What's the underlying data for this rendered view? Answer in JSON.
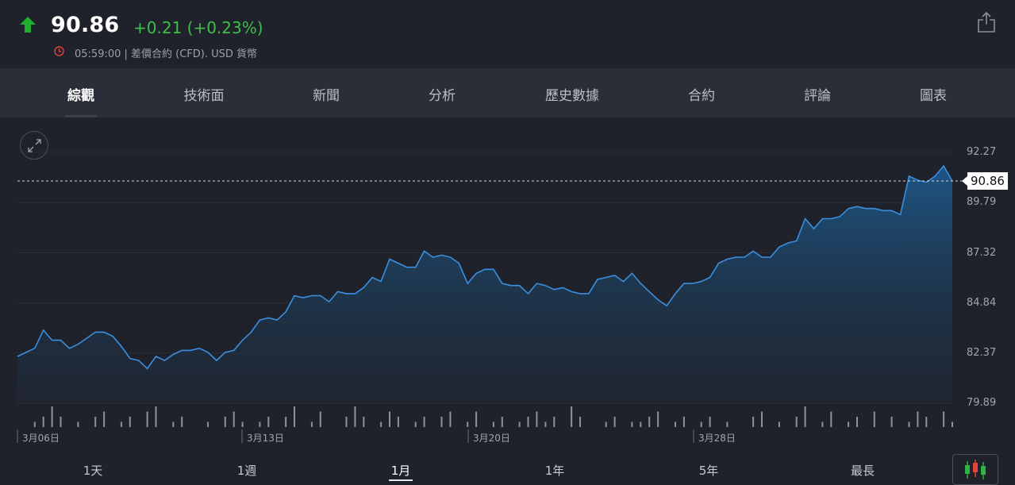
{
  "header": {
    "price": "90.86",
    "change": "+0.21 (+0.23%)",
    "meta": "05:59:00 | 差價合約 (CFD). USD 貨幣",
    "arrow_color": "#1fae2e",
    "change_color": "#3fbf4a",
    "clock_color": "#e0443c"
  },
  "tabs": [
    {
      "label": "綜觀",
      "active": true
    },
    {
      "label": "技術面"
    },
    {
      "label": "新聞"
    },
    {
      "label": "分析"
    },
    {
      "label": "歷史數據"
    },
    {
      "label": "合約"
    },
    {
      "label": "評論"
    },
    {
      "label": "圖表"
    }
  ],
  "chart_data": {
    "type": "area",
    "y_ticks": [
      "92.27",
      "89.79",
      "87.32",
      "84.84",
      "82.37",
      "79.89"
    ],
    "ylim": [
      79.89,
      92.27
    ],
    "x_ticks": [
      "3月06日",
      "3月13日",
      "3月20日",
      "3月28日"
    ],
    "last_price_label": "90.86",
    "line_color": "#3a8fe0",
    "values": [
      82.2,
      82.4,
      82.6,
      83.5,
      83.0,
      83.0,
      82.6,
      82.8,
      83.1,
      83.4,
      83.4,
      83.2,
      82.7,
      82.1,
      82.0,
      81.6,
      82.2,
      82.0,
      82.3,
      82.5,
      82.5,
      82.6,
      82.4,
      82.0,
      82.4,
      82.5,
      83.0,
      83.4,
      84.0,
      84.1,
      84.0,
      84.4,
      85.2,
      85.1,
      85.2,
      85.2,
      84.9,
      85.4,
      85.3,
      85.3,
      85.6,
      86.1,
      85.9,
      87.0,
      86.8,
      86.6,
      86.6,
      87.4,
      87.1,
      87.2,
      87.1,
      86.8,
      85.8,
      86.3,
      86.5,
      86.5,
      85.8,
      85.7,
      85.7,
      85.3,
      85.8,
      85.7,
      85.5,
      85.6,
      85.4,
      85.3,
      85.3,
      86.0,
      86.1,
      86.2,
      85.9,
      86.3,
      85.8,
      85.4,
      85.0,
      84.7,
      85.3,
      85.8,
      85.8,
      85.9,
      86.1,
      86.8,
      87.0,
      87.1,
      87.1,
      87.4,
      87.1,
      87.1,
      87.6,
      87.8,
      87.9,
      89.0,
      88.5,
      89.0,
      89.0,
      89.1,
      89.5,
      89.6,
      89.5,
      89.5,
      89.4,
      89.4,
      89.2,
      91.1,
      90.9,
      90.8,
      91.1,
      91.6,
      90.86
    ],
    "volume": [
      0,
      0,
      1,
      2,
      4,
      2,
      0,
      1,
      0,
      2,
      3,
      0,
      1,
      2,
      0,
      3,
      4,
      0,
      1,
      2,
      0,
      0,
      1,
      0,
      2,
      3,
      1,
      0,
      1,
      2,
      0,
      2,
      4,
      0,
      1,
      3,
      0,
      0,
      2,
      4,
      2,
      0,
      1,
      3,
      2,
      0,
      1,
      2,
      0,
      2,
      3,
      0,
      1,
      3,
      0,
      1,
      2,
      0,
      1,
      2,
      3,
      1,
      2,
      0,
      4,
      2,
      0,
      0,
      1,
      2,
      0,
      1,
      1,
      2,
      3,
      0,
      1,
      2,
      0,
      1,
      2,
      0,
      1,
      0,
      0,
      2,
      3,
      0,
      1,
      0,
      2,
      4,
      0,
      1,
      3,
      0,
      1,
      2,
      0,
      3,
      0,
      2,
      0,
      1,
      3,
      2,
      0,
      3,
      1
    ],
    "grid": true
  },
  "ranges": [
    {
      "label": "1天"
    },
    {
      "label": "1週"
    },
    {
      "label": "1月",
      "active": true
    },
    {
      "label": "1年"
    },
    {
      "label": "5年"
    },
    {
      "label": "最長"
    }
  ],
  "icons": {
    "up": "up-arrow-icon",
    "clock": "clock-icon",
    "share": "share-icon",
    "expand": "expand-icon",
    "candlestick": "candlestick-icon"
  }
}
